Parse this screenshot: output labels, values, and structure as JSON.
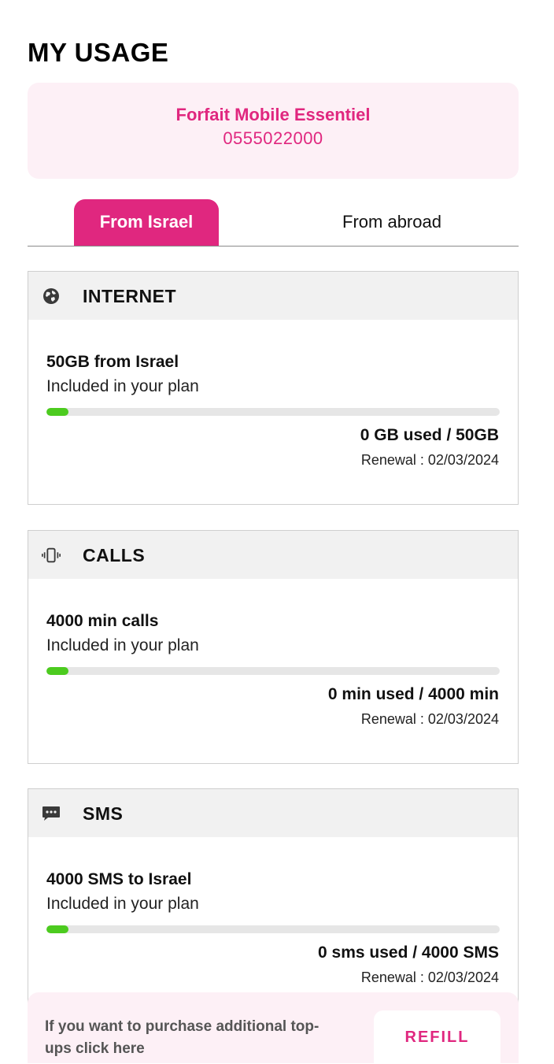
{
  "page": {
    "title": "MY USAGE"
  },
  "plan": {
    "name": "Forfait Mobile Essentiel",
    "number": "0555022000"
  },
  "tabs": [
    {
      "label": "From Israel",
      "active": true
    },
    {
      "label": "From abroad",
      "active": false
    }
  ],
  "colors": {
    "accent": "#e0277f",
    "progress": "#4ccb1f",
    "panel": "#fdf0f6"
  },
  "usage": [
    {
      "icon": "globe-icon",
      "title": "INTERNET",
      "allowance": "50GB from Israel",
      "included": "Included in your plan",
      "used_fraction": 0.0,
      "used_text": "0 GB used / 50GB",
      "renewal": "Renewal : 02/03/2024"
    },
    {
      "icon": "phone-vibrate-icon",
      "title": "CALLS",
      "allowance": "4000 min calls",
      "included": "Included in your plan",
      "used_fraction": 0.0,
      "used_text": "0 min used / 4000 min",
      "renewal": "Renewal : 02/03/2024"
    },
    {
      "icon": "chat-bubble-icon",
      "title": "SMS",
      "allowance": "4000 SMS to Israel",
      "included": "Included in your plan",
      "used_fraction": 0.0,
      "used_text": "0 sms used / 4000 SMS",
      "renewal": "Renewal : 02/03/2024"
    }
  ],
  "footer": {
    "text": "If you want to purchase additional top-ups click here",
    "button": "REFILL"
  }
}
